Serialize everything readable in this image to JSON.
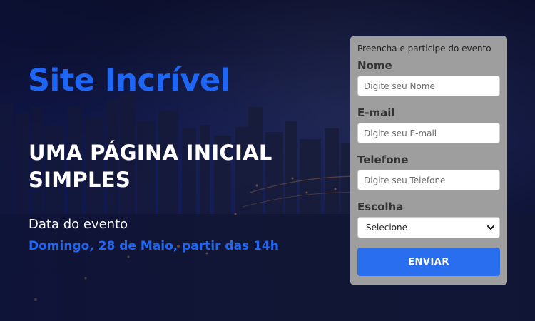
{
  "hero": {
    "site_title": "Site Incrível",
    "headline": "UMA PÁGINA INICIAL SIMPLES",
    "event_label": "Data do evento",
    "event_date": "Domingo, 28 de Maio, partir das 14h"
  },
  "form": {
    "intro": "Preencha e participe do evento",
    "fields": [
      {
        "label": "Nome",
        "placeholder": "Digite seu Nome"
      },
      {
        "label": "E-mail",
        "placeholder": "Digite seu E-mail"
      },
      {
        "label": "Telefone",
        "placeholder": "Digite seu Telefone"
      }
    ],
    "select": {
      "label": "Escolha",
      "value": "Selecione"
    },
    "submit_label": "ENVIAR"
  },
  "colors": {
    "accent": "#1e66f5",
    "button": "#2a6ef0",
    "card": "#9e9e9e"
  },
  "icons": {
    "select_arrow": "chevron-down-icon"
  }
}
